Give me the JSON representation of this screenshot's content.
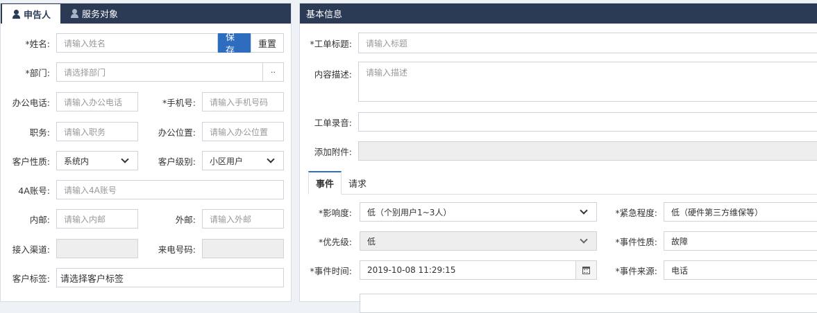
{
  "left": {
    "tabs": [
      {
        "label": "申告人",
        "active": true
      },
      {
        "label": "服务对象",
        "active": false
      }
    ],
    "name": {
      "label": "*姓名:",
      "placeholder": "请输入姓名"
    },
    "save_label": "保存",
    "reset_label": "重置",
    "dept": {
      "label": "*部门:",
      "placeholder": "请选择部门",
      "button": "··"
    },
    "office_phone": {
      "label": "办公电话:",
      "placeholder": "请输入办公电话"
    },
    "mobile": {
      "label": "*手机号:",
      "placeholder": "请输入手机号码"
    },
    "position": {
      "label": "职务:",
      "placeholder": "请输入职务"
    },
    "office_location": {
      "label": "办公位置:",
      "placeholder": "请输入办公位置"
    },
    "customer_nature": {
      "label": "客户性质:",
      "value": "系统内"
    },
    "customer_level": {
      "label": "客户级别:",
      "value": "小区用户"
    },
    "account_4a": {
      "label": "4A账号:",
      "placeholder": "请输入4A账号"
    },
    "internal_mail": {
      "label": "内邮:",
      "placeholder": "请输入内邮"
    },
    "external_mail": {
      "label": "外邮:",
      "placeholder": "请输入外邮"
    },
    "channel": {
      "label": "接入渠道:",
      "value": ""
    },
    "caller_number": {
      "label": "来电号码:",
      "value": ""
    },
    "customer_tag": {
      "label": "客户标签:",
      "value": "请选择客户标签"
    }
  },
  "right": {
    "header": "基本信息",
    "ticket_title": {
      "label": "*工单标题:",
      "placeholder": "请输入标题"
    },
    "description": {
      "label": "内容描述:",
      "placeholder": "请输入描述"
    },
    "recording": {
      "label": "工单录音:",
      "value": ""
    },
    "attachment": {
      "label": "添加附件:",
      "value": ""
    },
    "subtabs": [
      {
        "label": "事件",
        "active": true
      },
      {
        "label": "请求",
        "active": false
      }
    ],
    "impact": {
      "label": "*影响度:",
      "value": "低（个别用户1~3人）"
    },
    "urgency": {
      "label": "*紧急程度:",
      "value": "低（硬件第三方维保等）"
    },
    "priority": {
      "label": "*优先级:",
      "value": "低"
    },
    "event_nature": {
      "label": "*事件性质:",
      "value": "故障"
    },
    "event_time": {
      "label": "*事件时间:",
      "value": "2019-10-08 11:29:15"
    },
    "event_source": {
      "label": "*事件来源:",
      "value": "电话"
    }
  }
}
